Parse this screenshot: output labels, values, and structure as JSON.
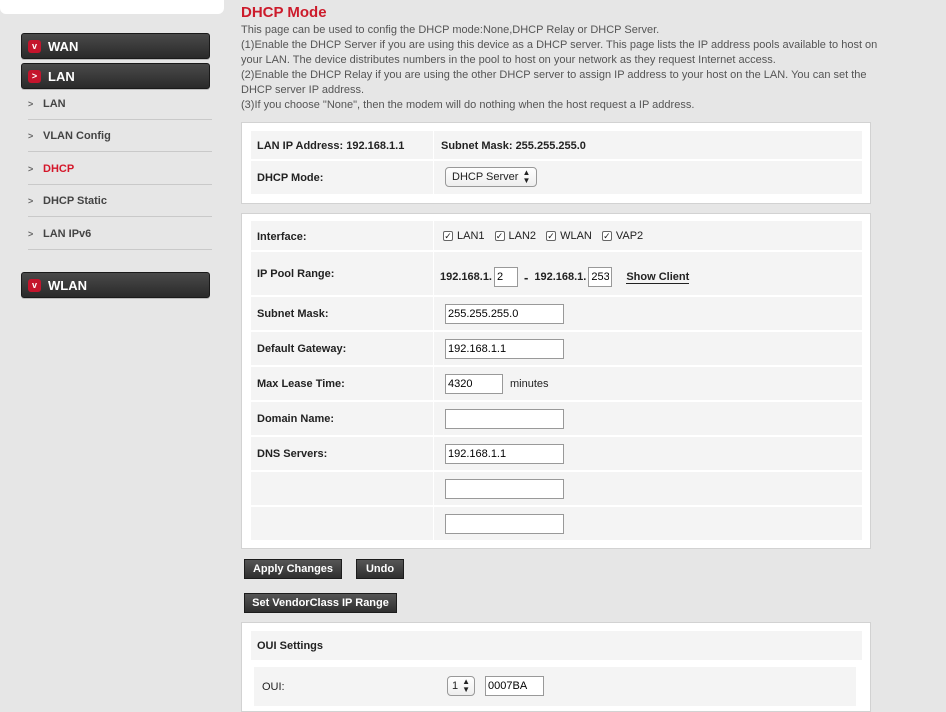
{
  "sidebar": {
    "wan": {
      "label": "WAN",
      "icon": "v"
    },
    "lan": {
      "label": "LAN",
      "icon": ">"
    },
    "lan_items": [
      {
        "label": "LAN"
      },
      {
        "label": "VLAN Config"
      },
      {
        "label": "DHCP"
      },
      {
        "label": "DHCP Static"
      },
      {
        "label": "LAN IPv6"
      }
    ],
    "wlan": {
      "label": "WLAN",
      "icon": "v"
    }
  },
  "page": {
    "title": "DHCP Mode",
    "description": [
      "This page can be used to config the DHCP mode:None,DHCP Relay or DHCP Server.",
      "(1)Enable the DHCP Server if you are using this device as a DHCP server. This page lists the IP address pools available to host on your LAN. The device distributes numbers in the pool to host on your network as they request Internet access.",
      "(2)Enable the DHCP Relay if you are using the other DHCP server to assign IP address to your host on the LAN. You can set the DHCP server IP address.",
      "(3)If you choose \"None\", then the modem will do nothing when the host request a IP address."
    ]
  },
  "mode_panel": {
    "lan_ip_label": "LAN IP Address: 192.168.1.1",
    "subnet_label": "Subnet Mask: 255.255.255.0",
    "dhcp_mode_label": "DHCP Mode:",
    "dhcp_mode_value": "DHCP Server"
  },
  "server_panel": {
    "interface_label": "Interface:",
    "interfaces": [
      "LAN1",
      "LAN2",
      "WLAN",
      "VAP2"
    ],
    "pool_label": "IP Pool Range:",
    "pool_prefix_start": "192.168.1.",
    "pool_start": "2",
    "pool_dash": "-",
    "pool_prefix_end": "192.168.1.",
    "pool_end": "253",
    "show_client": "Show Client",
    "subnet_label": "Subnet Mask:",
    "subnet_value": "255.255.255.0",
    "gateway_label": "Default Gateway:",
    "gateway_value": "192.168.1.1",
    "lease_label": "Max Lease Time:",
    "lease_value": "4320",
    "lease_unit": "minutes",
    "domain_label": "Domain Name:",
    "domain_value": "",
    "dns_label": "DNS Servers:",
    "dns_values": [
      "192.168.1.1",
      "",
      ""
    ]
  },
  "buttons": {
    "apply": "Apply Changes",
    "undo": "Undo",
    "vendor": "Set VendorClass IP Range"
  },
  "oui_panel": {
    "title": "OUI Settings",
    "oui_label": "OUI:",
    "oui_select": "1",
    "oui_value": "0007BA"
  }
}
